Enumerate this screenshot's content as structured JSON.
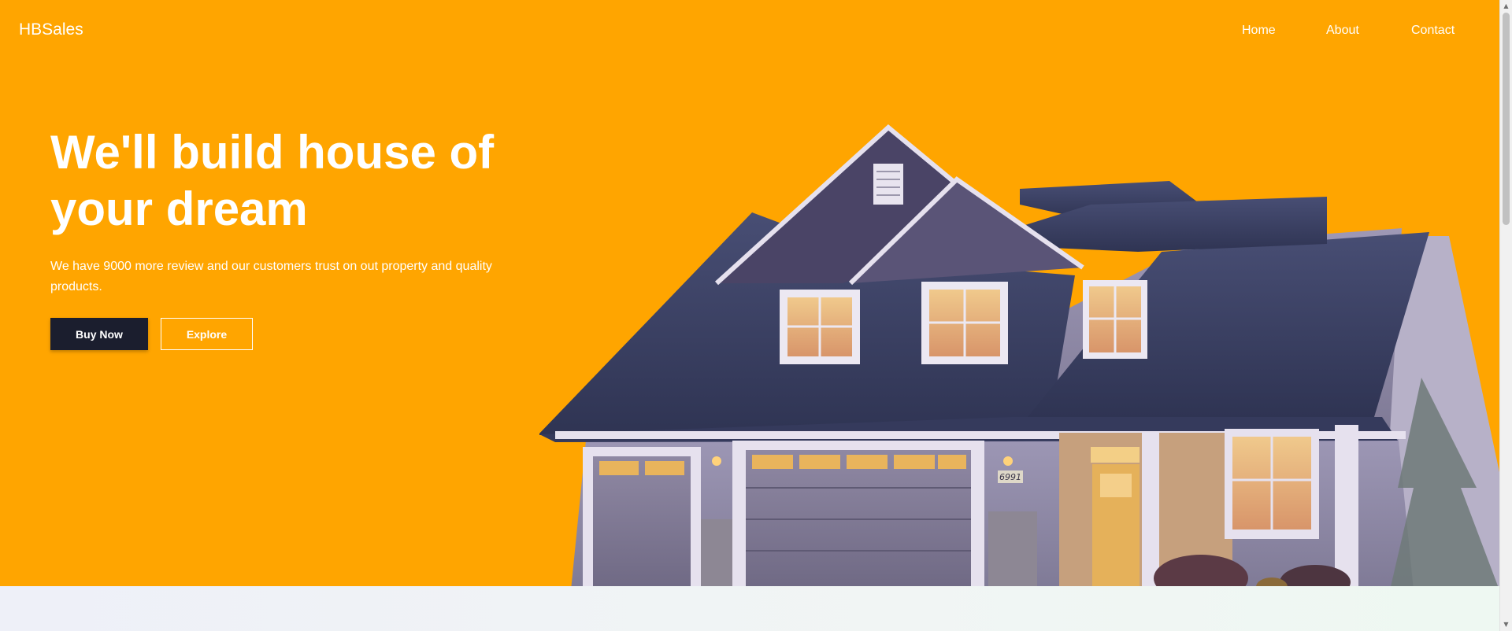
{
  "header": {
    "brand": "HBSales",
    "nav": [
      {
        "label": "Home"
      },
      {
        "label": "About"
      },
      {
        "label": "Contact"
      }
    ]
  },
  "hero": {
    "headline": "We'll build house of your dream",
    "subtext": "We have 9000 more review and our customers trust on out property and quality products.",
    "buy_label": "Buy Now",
    "explore_label": "Explore",
    "house_number": "6991"
  },
  "colors": {
    "hero_background": "#ffa500",
    "primary_button": "#1b1e2e",
    "text": "#ffffff",
    "roof": "#3c4266",
    "siding": "#8f8ba8"
  },
  "icons": {
    "scroll_up": "triangle-up",
    "scroll_down": "triangle-down"
  }
}
